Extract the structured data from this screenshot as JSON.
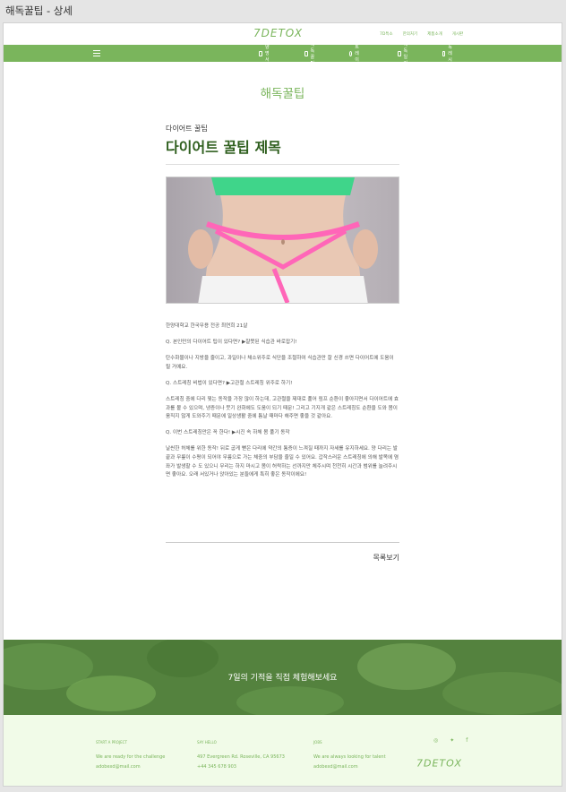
{
  "window": {
    "title": "해독꿀팁 - 상세"
  },
  "header": {
    "logo_text": "7DETOX",
    "top_links": [
      "7D특소",
      "한의처기",
      "제품소개",
      "게시판"
    ],
    "nav": [
      {
        "label": "양명서",
        "icon": "document-icon"
      },
      {
        "label": "해독꿀팁",
        "icon": "thumbs-up-icon"
      },
      {
        "label": "효트레이닝",
        "icon": "pulse-icon"
      },
      {
        "label": "해독일지",
        "icon": "notebook-icon"
      },
      {
        "label": "해독레시피",
        "icon": "recipe-icon"
      }
    ]
  },
  "page": {
    "section_title": "해독꿀팁",
    "category": "다이어트 꿀팁",
    "post_title": "다이어트 꿀팁 제목",
    "image_subject": "waist-measuring-tape",
    "paragraphs": [
      "한양대학교 한국무용 전공 최연희 21살",
      "Q. 본인만의 다이어트 팁이 있다면? ▶잘못된 식습관 바로잡기!",
      "탄수화물이나 지방을 줄이고, 과일이나 채소위주로 식단을 조절하여 식습관만 잘 신경 쓰면 다이어트에 도움이 될 거예요.",
      "Q. 스트레칭 비법이 있다면? ▶고관절 스트레칭 위주로 하기!",
      "스트레칭 중에 다리 찢는 동작을 가장 많이 하는데, 고관절을 제대로 풀어 림프 순환이 좋아지면서 다이어트에 효과를 볼 수 있으며, 냉증이나 붓기 완화에도 도움이 되기 때문! 그리고 기지개 같은 스트레칭도 순환을 도와 몸이 움직지 않게 도와주기 때문에 일상생활 중에 틈날 때마다 해주면 좋을 것 같아요.",
      "Q. 이번 스트레칭만은 꼭 한다! ▶시진 속 하체 몸 풀기 동작",
      "날씬한 허체를 위한 동작! 뒤로 굽게 뻗은 다리에 약간의 통증이 느껴질 때까지 자세를 유지하세요. 양 다리는 발끝과 무릎이 수평이 되어야 무릎으로 가는 체중의 부담을 줄일 수 있어요. 갑작스러운 스트레칭에 의해 발목에 염좌가 발생할 수 도 있으니 무리는 하지 마시고 몸이 허락하는 선까지만 체주시며 천천히 시간과 범위를 늘려주시면 좋아요. 오래 서있거나 앉아있는 분들에게 특히 좋은 동작이에요!"
    ],
    "list_button": "목록보기"
  },
  "banner": {
    "text": "7일의 기적을 직접 체험해보세요"
  },
  "footer": {
    "columns": [
      {
        "heading": "START A PROJECT",
        "lines": [
          "We are ready for the challenge",
          "adobexd@mail.com"
        ]
      },
      {
        "heading": "SAY HELLO",
        "lines": [
          "497 Evergreen Rd. Roseville, CA 95673",
          "+44 345 678 903"
        ]
      },
      {
        "heading": "JOBS",
        "lines": [
          "We are always looking for talent",
          "adobexd@mail.com"
        ]
      }
    ],
    "socials": [
      "instagram-icon",
      "twitter-icon",
      "facebook-icon"
    ],
    "social_glyphs": [
      "◎",
      "✦",
      "f"
    ],
    "logo_text": "7DETOX"
  },
  "colors": {
    "brand_green": "#7ab55c",
    "dark_green": "#2f5f1e",
    "banner_green": "#4f7d3d",
    "footer_bg": "#f1fbe8"
  }
}
